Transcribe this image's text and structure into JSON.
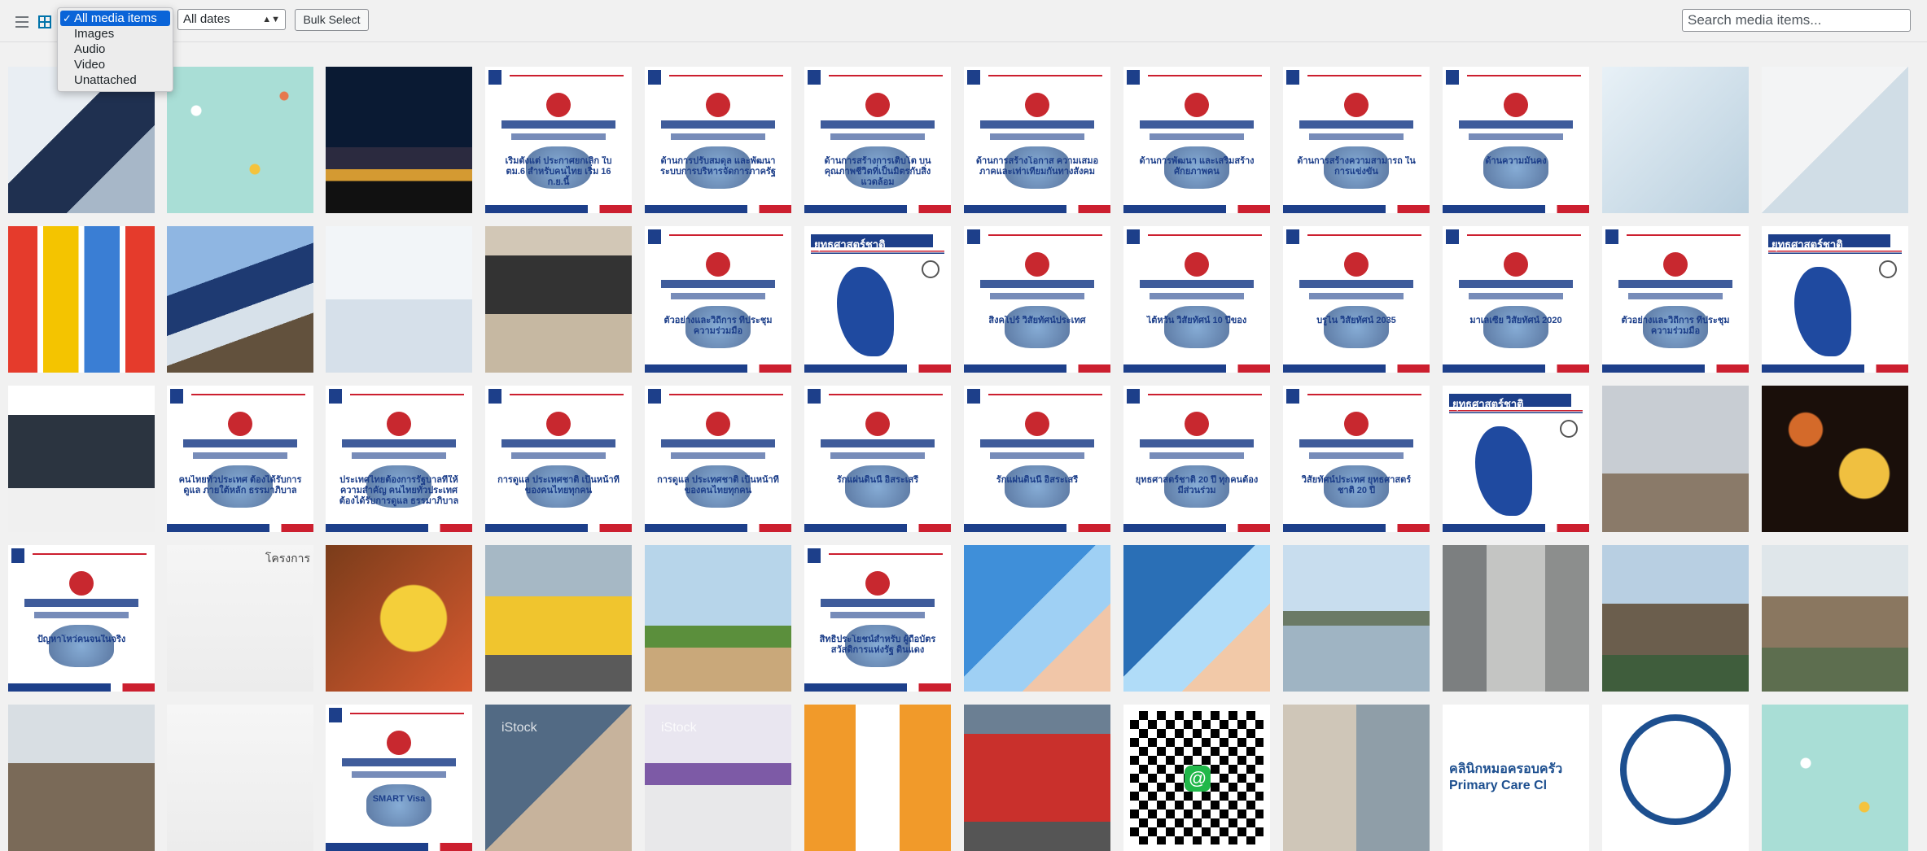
{
  "toolbar": {
    "view_list_icon": "list-view-icon",
    "view_grid_icon": "grid-view-icon",
    "type_filter": {
      "selected": "All media items",
      "options": [
        "All media items",
        "Images",
        "Audio",
        "Video",
        "Unattached"
      ]
    },
    "date_filter": {
      "selected": "All dates"
    },
    "bulk_select_label": "Bulk Select",
    "search_placeholder": "Search media items..."
  },
  "colors": {
    "accent": "#0073aa",
    "dropdown_highlight": "#0a64d8",
    "thai_navy": "#1d3f8a",
    "thai_red": "#cc1f2f"
  },
  "tiles": [
    {
      "kind": "photo",
      "scene": "businessman-airplane",
      "text": ""
    },
    {
      "kind": "photo",
      "scene": "pills-teal",
      "text": ""
    },
    {
      "kind": "photo",
      "scene": "airport-night",
      "text": ""
    },
    {
      "kind": "poster",
      "scene": "passport",
      "text": "เริ่มตั้งแต่ ประกาศยกเลิก ใบ ตม.6 สำหรับคนไทย เริ่ม 16 ก.ย.นี้"
    },
    {
      "kind": "poster",
      "scene": "policy-6",
      "text": "ด้านการปรับสมดุล และพัฒนาระบบการบริหารจัดการภาครัฐ"
    },
    {
      "kind": "poster",
      "scene": "policy-5",
      "text": "ด้านการสร้างการเติบโต บนคุณภาพชีวิตที่เป็นมิตรกับสิ่งแวดล้อม"
    },
    {
      "kind": "poster",
      "scene": "policy-4",
      "text": "ด้านการสร้างโอกาส ความเสมอภาคและเท่าเทียมกันทางสังคม"
    },
    {
      "kind": "poster",
      "scene": "policy-3",
      "text": "ด้านการพัฒนา และเสริมสร้างศักยภาพคน"
    },
    {
      "kind": "poster",
      "scene": "policy-2",
      "text": "ด้านการสร้างความสามารถ ในการแข่งขัน"
    },
    {
      "kind": "poster",
      "scene": "policy-1",
      "text": "ด้านความมั่นคง"
    },
    {
      "kind": "photo",
      "scene": "doctor-hands",
      "text": ""
    },
    {
      "kind": "photo",
      "scene": "baby-clinic",
      "text": ""
    },
    {
      "kind": "photo",
      "scene": "buses",
      "text": ""
    },
    {
      "kind": "photo",
      "scene": "highspeed-train",
      "text": ""
    },
    {
      "kind": "photo",
      "scene": "business-people-walking",
      "text": ""
    },
    {
      "kind": "photo",
      "scene": "laptop-website",
      "text": ""
    },
    {
      "kind": "poster",
      "scene": "asean-costumes",
      "text": "ตัวอย่างและวิถีการ ที่ประชุมความร่วมมือ"
    },
    {
      "kind": "map",
      "scene": "strategy-map",
      "text": "ยุทธศาสตร์ชาติ"
    },
    {
      "kind": "poster",
      "scene": "singapore",
      "text": "สิงคโปร์ วิสัยทัศน์ประเทศ"
    },
    {
      "kind": "poster",
      "scene": "taiwan",
      "text": "ไต้หวัน วิสัยทัศน์ 10 ปีของ"
    },
    {
      "kind": "poster",
      "scene": "brunei",
      "text": "บรูไน วิสัยทัศน์ 2035"
    },
    {
      "kind": "poster",
      "scene": "malaysia",
      "text": "มาเลเซีย วิสัยทัศน์ 2020"
    },
    {
      "kind": "poster",
      "scene": "asean-costumes-2",
      "text": "ตัวอย่างและวิถีการ ที่ประชุมความร่วมมือ"
    },
    {
      "kind": "map",
      "scene": "strategy-map-2",
      "text": "ยุทธศาสตร์ชาติ"
    },
    {
      "kind": "photo",
      "scene": "devices-website",
      "text": ""
    },
    {
      "kind": "poster",
      "scene": "pm-quote-1",
      "text": "คนไทยทั่วประเทศ ต้องได้รับการดูแล ภายใต้หลัก ธรรมาภิบาล"
    },
    {
      "kind": "poster",
      "scene": "pm-quote-2",
      "text": "ประเทศไทยต้องการรัฐบาลที่ให้ความสำคัญ คนไทยทั่วประเทศ ต้องได้รับการดูแล ธรรมาภิบาล"
    },
    {
      "kind": "poster",
      "scene": "pm-quote-3",
      "text": "การดูแล ประเทศชาติ เป็นหน้าที่ ของคนไทยทุกคน"
    },
    {
      "kind": "poster",
      "scene": "pm-quote-4",
      "text": "การดูแล ประเทศชาติ เป็นหน้าที่ ของคนไทยทุกคน"
    },
    {
      "kind": "poster",
      "scene": "pm-quote-5",
      "text": "รักแผ่นดินนี้ อิสระเสรี"
    },
    {
      "kind": "poster",
      "scene": "pm-quote-6",
      "text": "รักแผ่นดินนี้ อิสระเสรี"
    },
    {
      "kind": "poster",
      "scene": "strategy-6",
      "text": "ยุทธศาสตร์ชาติ 20 ปี ทุกคนต้องมีส่วนร่วม"
    },
    {
      "kind": "poster",
      "scene": "vision",
      "text": "วิสัยทัศน์ประเทศ ยุทธศาสตร์ชาติ 20 ปี"
    },
    {
      "kind": "map",
      "scene": "strategy-map-3",
      "text": "ยุทธศาสตร์ชาติ"
    },
    {
      "kind": "photo",
      "scene": "feet-shoes",
      "text": ""
    },
    {
      "kind": "photo",
      "scene": "phone-wifi-bokeh",
      "text": ""
    },
    {
      "kind": "poster",
      "scene": "housing",
      "text": "ปัญหาโหว่คนจนในจริง"
    },
    {
      "kind": "photo",
      "scene": "rail-map",
      "text": "โครงการ"
    },
    {
      "kind": "photo",
      "scene": "phone-wifi",
      "text": ""
    },
    {
      "kind": "photo",
      "scene": "taxi",
      "text": ""
    },
    {
      "kind": "photo",
      "scene": "tree-city",
      "text": ""
    },
    {
      "kind": "poster",
      "scene": "benefits-card",
      "text": "สิทธิประโยชน์สำหรับ ผู้ถือบัตรสวัสดิการแห่งรัฐ ดินแดง"
    },
    {
      "kind": "photo",
      "scene": "id-card-1",
      "text": ""
    },
    {
      "kind": "photo",
      "scene": "id-card-2",
      "text": ""
    },
    {
      "kind": "photo",
      "scene": "canal",
      "text": ""
    },
    {
      "kind": "photo",
      "scene": "empty-room",
      "text": ""
    },
    {
      "kind": "photo",
      "scene": "slum-houses",
      "text": ""
    },
    {
      "kind": "photo",
      "scene": "riverside-houses",
      "text": ""
    },
    {
      "kind": "photo",
      "scene": "demolition",
      "text": ""
    },
    {
      "kind": "photo",
      "scene": "purple-line-map",
      "text": ""
    },
    {
      "kind": "poster",
      "scene": "smart-visa",
      "text": "SMART Visa"
    },
    {
      "kind": "photo",
      "scene": "istock-team",
      "text": "iStock"
    },
    {
      "kind": "photo",
      "scene": "istock-train",
      "text": "iStock"
    },
    {
      "kind": "photo",
      "scene": "buses-arrow",
      "text": ""
    },
    {
      "kind": "photo",
      "scene": "red-bus",
      "text": ""
    },
    {
      "kind": "photo",
      "scene": "qr-code",
      "text": ""
    },
    {
      "kind": "photo",
      "scene": "elderly-collage",
      "text": ""
    },
    {
      "kind": "photo",
      "scene": "clinic-logo",
      "text": "คลินิกหมอครอบครัว Primary Care Cl"
    },
    {
      "kind": "photo",
      "scene": "tv-logo",
      "text": ""
    },
    {
      "kind": "photo",
      "scene": "pills-teal-2",
      "text": ""
    }
  ]
}
